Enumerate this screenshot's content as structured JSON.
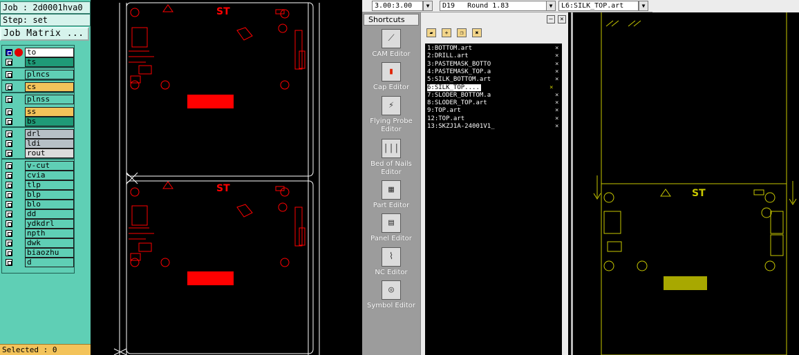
{
  "job_panel": {
    "job": "Job : 2d0001hva0",
    "step": "Step: set",
    "job_matrix_button": "Job Matrix ...",
    "selected": "Selected : 0"
  },
  "layers": [
    {
      "name": "to",
      "color": "#ffffff",
      "active": true
    },
    {
      "name": "ts",
      "color": "#1f9a77"
    },
    {
      "name": "plncs",
      "color": "#5fcfb5"
    },
    {
      "name": "cs",
      "color": "#f3c35a"
    },
    {
      "name": "plnss",
      "color": "#5fcfb5"
    },
    {
      "name": "ss",
      "color": "#f3c35a"
    },
    {
      "name": "bs",
      "color": "#1f9a77"
    },
    {
      "name": "drl",
      "color": "#b7c0c6"
    },
    {
      "name": "ldi",
      "color": "#b7c0c6"
    },
    {
      "name": "rout",
      "color": "#dcdcdc"
    },
    {
      "name": "v-cut",
      "color": "#5fcfb5"
    },
    {
      "name": "cvia",
      "color": "#5fcfb5"
    },
    {
      "name": "tlp",
      "color": "#5fcfb5"
    },
    {
      "name": "blp",
      "color": "#5fcfb5"
    },
    {
      "name": "blo",
      "color": "#5fcfb5"
    },
    {
      "name": "dd",
      "color": "#5fcfb5"
    },
    {
      "name": "ydkdrl",
      "color": "#5fcfb5"
    },
    {
      "name": "npth",
      "color": "#5fcfb5"
    },
    {
      "name": "dwk",
      "color": "#5fcfb5"
    },
    {
      "name": "biaozhu",
      "color": "#5fcfb5"
    },
    {
      "name": "d",
      "color": "#5fcfb5"
    }
  ],
  "toolbar": {
    "grid": "3.00:3.00",
    "dcode": "D19",
    "aperture": "Round 1.83",
    "layer": "L6:SILK_TOP.art"
  },
  "shortcuts": {
    "title": "Shortcuts",
    "items": [
      {
        "label": "CAM Editor",
        "icon": "cam-editor-icon"
      },
      {
        "label": "Cap Editor",
        "icon": "cap-editor-icon"
      },
      {
        "label": "Flying Probe Editor",
        "icon": "flying-probe-icon"
      },
      {
        "label": "Bed of Nails Editor",
        "icon": "bed-of-nails-icon"
      },
      {
        "label": "Part Editor",
        "icon": "part-editor-icon"
      },
      {
        "label": "Panel Editor",
        "icon": "panel-editor-icon"
      },
      {
        "label": "NC Editor",
        "icon": "nc-editor-icon"
      },
      {
        "label": "Symbol Editor",
        "icon": "symbol-editor-icon"
      }
    ]
  },
  "layer_list": [
    {
      "label": "1:BOTTOM.art"
    },
    {
      "label": "2:DRILL.art"
    },
    {
      "label": "3:PASTEMASK_BOTTO"
    },
    {
      "label": "4:PASTEMASK_TOP.a"
    },
    {
      "label": "5:SILK_BOTTOM.art"
    },
    {
      "label": "6:SILK_TOP....",
      "active": true
    },
    {
      "label": "7:SLODER_BOTTOM.a"
    },
    {
      "label": "8:SLODER_TOP.art"
    },
    {
      "label": "9:TOP.art"
    },
    {
      "label": "12:TOP.art"
    },
    {
      "label": "13:SKZJ1A-24001V1_"
    }
  ],
  "layer_list_close": "×",
  "colors": {
    "panel": "#5fcfb5",
    "canvas_feature": "#ff0000",
    "board_outline": "#ffffff",
    "right_view_feature": "#c8c800",
    "selected_bar": "#f3c35a"
  }
}
